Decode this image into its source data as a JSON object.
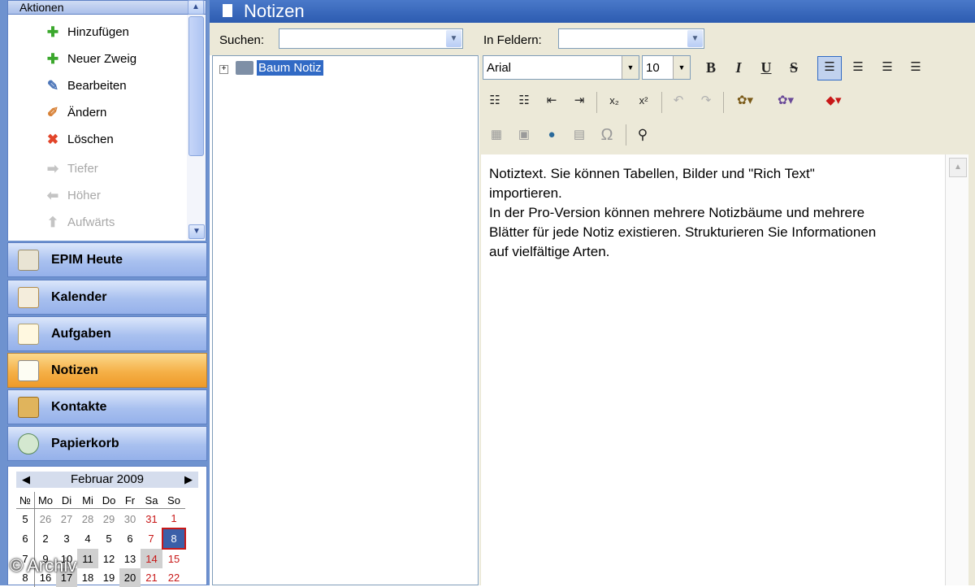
{
  "actions": {
    "header": "Aktionen",
    "items": [
      {
        "label": "Hinzufügen",
        "icon": "plus-icon",
        "enabled": true
      },
      {
        "label": "Neuer Zweig",
        "icon": "new-branch-icon",
        "enabled": true
      },
      {
        "label": "Bearbeiten",
        "icon": "edit-icon",
        "enabled": true
      },
      {
        "label": "Ändern",
        "icon": "modify-icon",
        "enabled": true
      },
      {
        "label": "Löschen",
        "icon": "delete-icon",
        "enabled": true
      },
      {
        "label": "Tiefer",
        "icon": "arrow-right-icon",
        "enabled": false
      },
      {
        "label": "Höher",
        "icon": "arrow-left-icon",
        "enabled": false
      },
      {
        "label": "Aufwärts",
        "icon": "arrow-up-icon",
        "enabled": false
      }
    ]
  },
  "nav": [
    {
      "label": "EPIM Heute",
      "icon": "today-icon",
      "active": false
    },
    {
      "label": "Kalender",
      "icon": "calendar-icon",
      "active": false
    },
    {
      "label": "Aufgaben",
      "icon": "tasks-icon",
      "active": false
    },
    {
      "label": "Notizen",
      "icon": "notes-icon",
      "active": true
    },
    {
      "label": "Kontakte",
      "icon": "contacts-icon",
      "active": false
    },
    {
      "label": "Papierkorb",
      "icon": "recycle-bin-icon",
      "active": false
    }
  ],
  "calendar": {
    "title": "Februar  2009",
    "headers": [
      "№",
      "Mo",
      "Di",
      "Mi",
      "Do",
      "Fr",
      "Sa",
      "So"
    ],
    "weeks": [
      [
        "5",
        "26",
        "27",
        "28",
        "29",
        "30",
        "31",
        "1"
      ],
      [
        "6",
        "2",
        "3",
        "4",
        "5",
        "6",
        "7",
        "8"
      ],
      [
        "7",
        "9",
        "10",
        "11",
        "12",
        "13",
        "14",
        "15"
      ],
      [
        "8",
        "16",
        "17",
        "18",
        "19",
        "20",
        "21",
        "22"
      ]
    ],
    "today": "8"
  },
  "main": {
    "title": "Notizen",
    "search_label": "Suchen:",
    "search_value": "",
    "fields_label": "In Feldern:",
    "fields_value": ""
  },
  "tree": {
    "expander": "+",
    "root_label": "Baum Notiz"
  },
  "toolbar": {
    "font": "Arial",
    "size": "10",
    "bold": "B",
    "italic": "I",
    "underline": "U",
    "strike": "S",
    "omega": "Ω"
  },
  "document": {
    "lines": [
      "Notiztext. Sie können Tabellen, Bilder und \"Rich Text\"",
      "importieren.",
      "In der Pro-Version können mehrere Notizbäume und mehrere",
      "Blätter für jede Notiz existieren. Strukturieren Sie Informationen",
      "auf vielfältige Arten."
    ]
  },
  "watermark": "© Archiv",
  "colors": {
    "accent": "#316ac5",
    "active_nav": "#f5b047",
    "title_bar": "#2c5bb0"
  }
}
